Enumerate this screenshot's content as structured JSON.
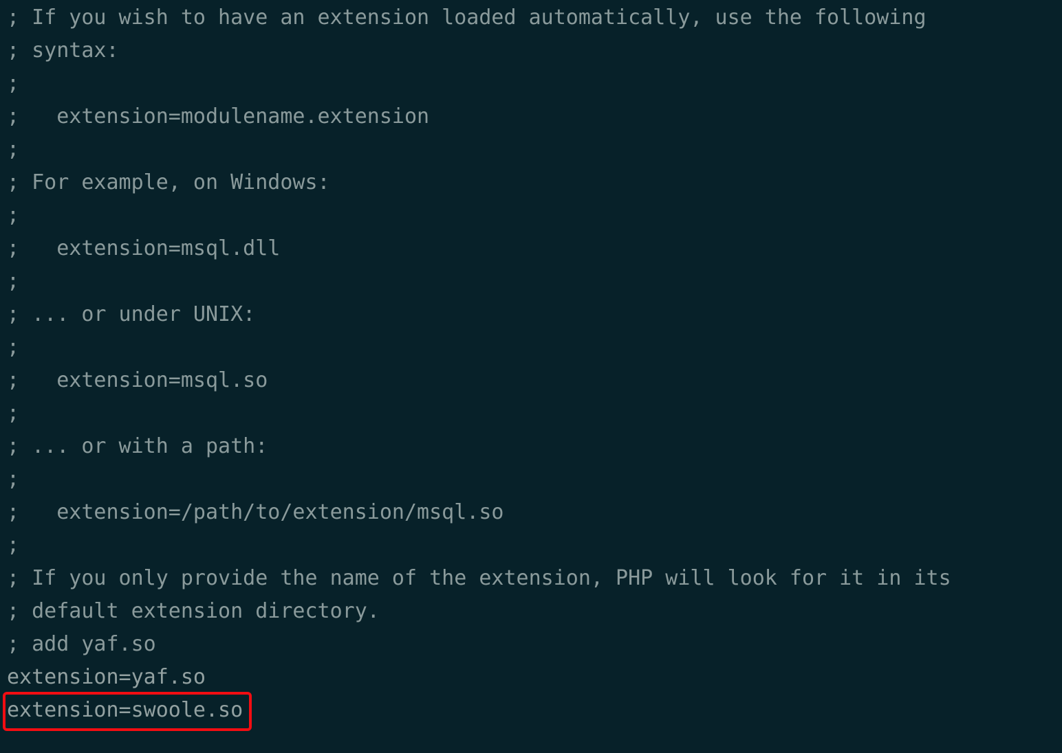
{
  "config_lines": [
    "; If you wish to have an extension loaded automatically, use the following",
    "; syntax:",
    ";",
    ";   extension=modulename.extension",
    ";",
    "; For example, on Windows:",
    ";",
    ";   extension=msql.dll",
    ";",
    "; ... or under UNIX:",
    ";",
    ";   extension=msql.so",
    ";",
    "; ... or with a path:",
    ";",
    ";   extension=/path/to/extension/msql.so",
    ";",
    "; If you only provide the name of the extension, PHP will look for it in its",
    "; default extension directory.",
    "; add yaf.so",
    "extension=yaf.so",
    "extension=swoole.so"
  ],
  "highlighted_line": "extension=swoole.so",
  "colors": {
    "background": "#072129",
    "text": "#8a9a9b",
    "highlight_border": "#f20d12"
  }
}
